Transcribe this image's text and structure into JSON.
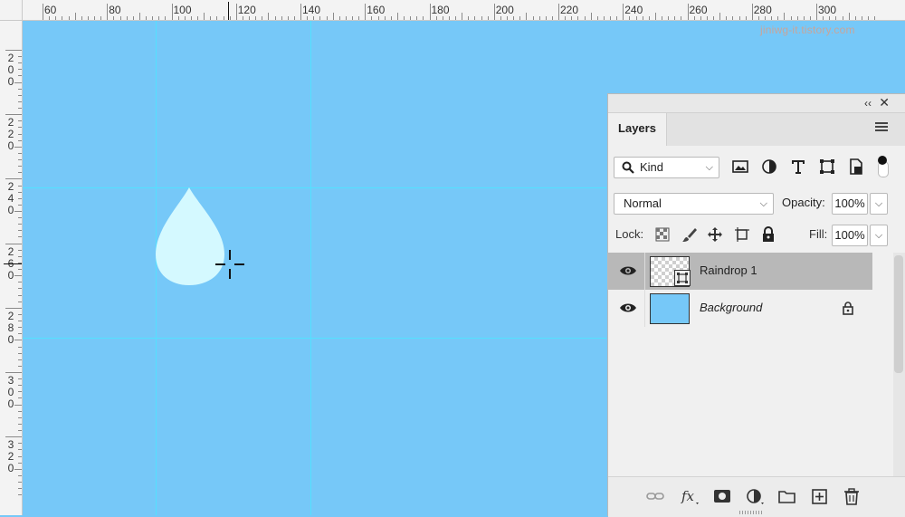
{
  "ruler": {
    "top_labels": [
      "60",
      "80",
      "100",
      "120",
      "140",
      "160",
      "180",
      "200",
      "220",
      "240",
      "260",
      "280",
      "300"
    ],
    "left_groups": [
      [
        "2",
        "0",
        "0"
      ],
      [
        "2",
        "2",
        "0"
      ],
      [
        "2",
        "4",
        "0"
      ],
      [
        "2",
        "6",
        "0"
      ],
      [
        "2",
        "8",
        "0"
      ],
      [
        "3",
        "0",
        "0"
      ],
      [
        "3",
        "2",
        "0"
      ]
    ]
  },
  "watermark": "jiniwg-it.tistory.com",
  "canvas": {
    "background_color": "#76c8f8",
    "guide_color": "#53e1ff",
    "drop_color": "#d4f9ff"
  },
  "panel": {
    "tab_label": "Layers",
    "filter": {
      "kind_label": "Kind",
      "icons": [
        "image-filter-icon",
        "adjustment-filter-icon",
        "type-filter-icon",
        "shape-filter-icon",
        "smart-object-filter-icon"
      ]
    },
    "blend_mode": "Normal",
    "opacity_label": "Opacity:",
    "opacity_value": "100%",
    "lock_label": "Lock:",
    "fill_label": "Fill:",
    "fill_value": "100%",
    "layers": [
      {
        "name": "Raindrop 1",
        "selected": true,
        "visible": true,
        "type": "smart-object"
      },
      {
        "name": "Background",
        "selected": false,
        "visible": true,
        "locked": true
      }
    ],
    "bottom_icons": [
      "link-layers-icon",
      "fx-icon",
      "mask-icon",
      "adjustment-layer-icon",
      "group-folder-icon",
      "new-layer-icon",
      "trash-icon"
    ]
  }
}
